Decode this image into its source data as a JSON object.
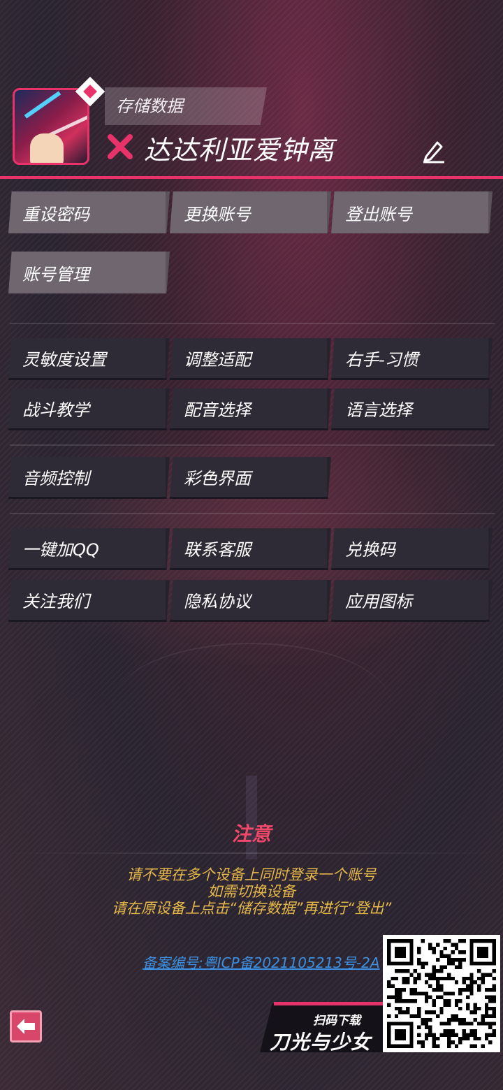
{
  "header": {
    "save_label": "存储数据",
    "user_name": "达达利亚爱钟离"
  },
  "account_buttons": [
    {
      "label": "重设密码"
    },
    {
      "label": "更换账号"
    },
    {
      "label": "登出账号"
    },
    {
      "label": "账号管理"
    }
  ],
  "settings_buttons": [
    {
      "label": "灵敏度设置"
    },
    {
      "label": "调整适配"
    },
    {
      "label": "右手-习惯"
    },
    {
      "label": "战斗教学"
    },
    {
      "label": "配音选择"
    },
    {
      "label": "语言选择"
    }
  ],
  "media_buttons": [
    {
      "label": "音频控制"
    },
    {
      "label": "彩色界面"
    }
  ],
  "social_buttons": [
    {
      "label": "一键加QQ"
    },
    {
      "label": "联系客服"
    },
    {
      "label": "兑换码"
    },
    {
      "label": "关注我们"
    },
    {
      "label": "隐私协议"
    },
    {
      "label": "应用图标"
    }
  ],
  "notice": {
    "title": "注意",
    "lines": [
      "请不要在多个设备上同时登录一个账号",
      "如需切换设备",
      "请在原设备上点击“储存数据”再进行“登出”"
    ]
  },
  "icp": "备案编号:粤ICP备2021105213号-2A",
  "promo": {
    "scan_label": "扫码下载",
    "game_title": "刀光与少女"
  },
  "colors": {
    "accent": "#e8336a",
    "notice_title": "#f2486a",
    "notice_text": "#e6b84a",
    "link": "#3d8fe0"
  },
  "icons": {
    "status": "close-x-icon",
    "edit": "pencil-icon",
    "back": "arrow-left-icon"
  }
}
